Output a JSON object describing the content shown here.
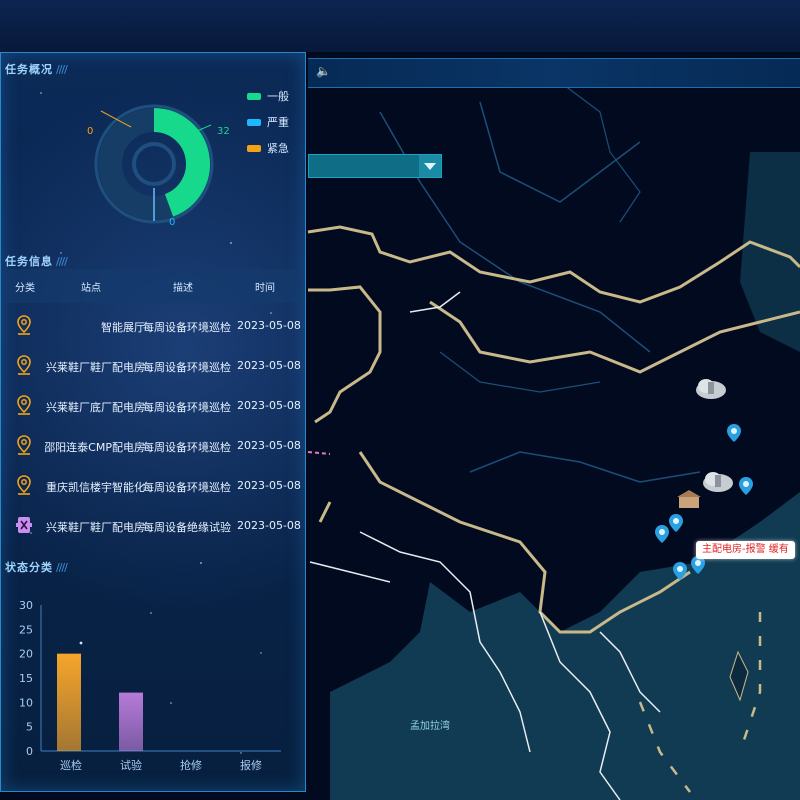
{
  "map": {
    "sea_label": "孟加拉湾",
    "alarm_label": "主配电房-报警 缓有",
    "speaker_icon": "speaker-icon",
    "colors": {
      "land": "#020a1f",
      "sea": "#113b52",
      "border": "#c9b98a",
      "river": "#1c4f78",
      "marker": "#2aa0e0"
    }
  },
  "panel": {
    "task_overview": {
      "title": "任务概况",
      "slashes": "////",
      "legend": [
        {
          "label": "一般",
          "color": "#17d98b"
        },
        {
          "label": "严重",
          "color": "#1fb8ff"
        },
        {
          "label": "紧急",
          "color": "#f3a316"
        }
      ],
      "values": {
        "normal": 32,
        "severe": 0,
        "urgent": 0
      },
      "labels": {
        "normal": "32",
        "severe": "0",
        "urgent": "0"
      }
    },
    "task_info": {
      "title": "任务信息",
      "slashes": "////",
      "headers": {
        "category": "分类",
        "site": "站点",
        "description": "描述",
        "time": "时间"
      },
      "rows": [
        {
          "icon": "inspection-pin-icon",
          "site": "智能展厅",
          "description": "每周设备环境巡检",
          "time": "2023-05-08"
        },
        {
          "icon": "inspection-pin-icon",
          "site": "兴莱鞋厂鞋厂配电房",
          "description": "每周设备环境巡检",
          "time": "2023-05-08"
        },
        {
          "icon": "inspection-pin-icon",
          "site": "兴莱鞋厂底厂配电房",
          "description": "每周设备环境巡检",
          "time": "2023-05-08"
        },
        {
          "icon": "inspection-pin-icon",
          "site": "邵阳连泰CMP配电房",
          "description": "每周设备环境巡检",
          "time": "2023-05-08"
        },
        {
          "icon": "inspection-pin-icon",
          "site": "重庆凯信楼宇智能化",
          "description": "每周设备环境巡检",
          "time": "2023-05-08"
        },
        {
          "icon": "test-device-icon",
          "site": "兴莱鞋厂鞋厂配电房",
          "description": "每周设备绝缘试验",
          "time": "2023-05-08"
        }
      ]
    },
    "status_class": {
      "title": "状态分类",
      "slashes": "////"
    }
  },
  "chart_data": {
    "type": "bar",
    "categories": [
      "巡检",
      "试验",
      "抢修",
      "报修"
    ],
    "values": [
      20,
      12,
      0,
      0
    ],
    "xlabel": "",
    "ylabel": "",
    "ylim": [
      0,
      30
    ],
    "yticks": [
      0,
      5,
      10,
      15,
      20,
      25,
      30
    ],
    "colors": [
      "#f7a52b",
      "#b77ad8",
      "#1fb8ff",
      "#17d98b"
    ]
  }
}
